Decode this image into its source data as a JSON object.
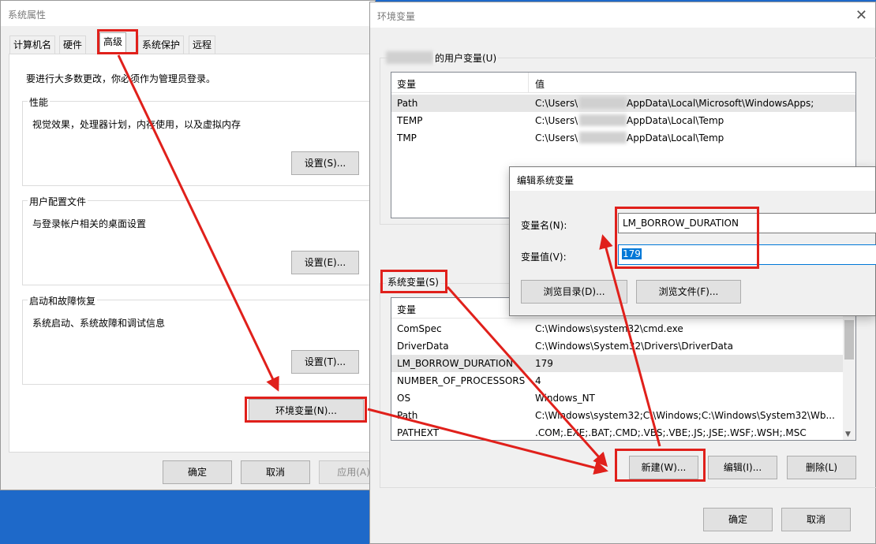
{
  "sys_props": {
    "title": "系统属性",
    "tabs": [
      "计算机名",
      "硬件",
      "高级",
      "系统保护",
      "远程"
    ],
    "admin_note": "要进行大多数更改，你必须作为管理员登录。",
    "performance": {
      "label": "性能",
      "desc": "视觉效果，处理器计划，内存使用，以及虚拟内存",
      "button": "设置(S)..."
    },
    "profiles": {
      "label": "用户配置文件",
      "desc": "与登录帐户相关的桌面设置",
      "button": "设置(E)..."
    },
    "startup": {
      "label": "启动和故障恢复",
      "desc": "系统启动、系统故障和调试信息",
      "button": "设置(T)..."
    },
    "env_button": "环境变量(N)...",
    "ok": "确定",
    "cancel": "取消",
    "apply": "应用(A)"
  },
  "env_vars": {
    "title": "环境变量",
    "user_group_label": "的用户变量(U)",
    "col_var": "变量",
    "col_val": "值",
    "user_rows": [
      {
        "name": "Path",
        "pre": "C:\\Users\\",
        "post": "AppData\\Local\\Microsoft\\WindowsApps;"
      },
      {
        "name": "TEMP",
        "pre": "C:\\Users\\",
        "post": "AppData\\Local\\Temp"
      },
      {
        "name": "TMP",
        "pre": "C:\\Users\\",
        "post": "AppData\\Local\\Temp"
      }
    ],
    "system_group_label": "系统变量(S)",
    "system_rows": [
      {
        "name": "ComSpec",
        "value": "C:\\Windows\\system32\\cmd.exe"
      },
      {
        "name": "DriverData",
        "value": "C:\\Windows\\System32\\Drivers\\DriverData"
      },
      {
        "name": "LM_BORROW_DURATION",
        "value": "179"
      },
      {
        "name": "NUMBER_OF_PROCESSORS",
        "value": "4"
      },
      {
        "name": "OS",
        "value": "Windows_NT"
      },
      {
        "name": "Path",
        "value": "C:\\Windows\\system32;C:\\Windows;C:\\Windows\\System32\\Wb..."
      },
      {
        "name": "PATHEXT",
        "value": ".COM;.EXE;.BAT;.CMD;.VBS;.VBE;.JS;.JSE;.WSF;.WSH;.MSC"
      }
    ],
    "new_button": "新建(W)...",
    "edit_button": "编辑(I)...",
    "delete_button": "删除(L)",
    "ok": "确定",
    "cancel": "取消"
  },
  "edit_dialog": {
    "title": "编辑系统变量",
    "name_label": "变量名(N):",
    "name_value": "LM_BORROW_DURATION",
    "value_label": "变量值(V):",
    "value_value": "179",
    "browse_dir": "浏览目录(D)...",
    "browse_file": "浏览文件(F)..."
  },
  "colors": {
    "highlight": "#e0201b",
    "selection": "#0078d7",
    "desktop": "#1e69c9"
  }
}
